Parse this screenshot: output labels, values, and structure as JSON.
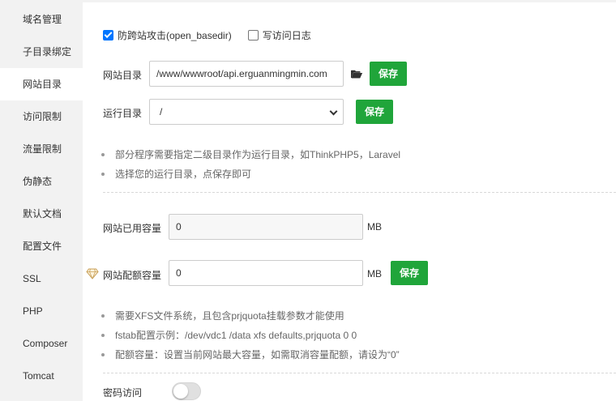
{
  "sidebar": {
    "items": [
      {
        "label": "域名管理"
      },
      {
        "label": "子目录绑定"
      },
      {
        "label": "网站目录"
      },
      {
        "label": "访问限制"
      },
      {
        "label": "流量限制"
      },
      {
        "label": "伪静态"
      },
      {
        "label": "默认文档"
      },
      {
        "label": "配置文件"
      },
      {
        "label": "SSL"
      },
      {
        "label": "PHP"
      },
      {
        "label": "Composer"
      },
      {
        "label": "Tomcat"
      }
    ],
    "active_index": 2
  },
  "options": {
    "open_basedir_label": "防跨站攻击(open_basedir)",
    "open_basedir_checked": true,
    "access_log_label": "写访问日志",
    "access_log_checked": false
  },
  "site_dir": {
    "label": "网站目录",
    "value": "/www/wwwroot/api.erguanmingmin.com",
    "save_label": "保存",
    "folder_icon": "folder-open-icon"
  },
  "run_dir": {
    "label": "运行目录",
    "selected": "/",
    "save_label": "保存"
  },
  "dir_tips": [
    "部分程序需要指定二级目录作为运行目录，如ThinkPHP5，Laravel",
    "选择您的运行目录，点保存即可"
  ],
  "quota": {
    "used_label": "网站已用容量",
    "used_value": "0",
    "used_unit": "MB",
    "quota_label": "网站配额容量",
    "quota_value": "0",
    "quota_unit": "MB",
    "save_label": "保存",
    "premium_icon": "gem-icon"
  },
  "quota_tips": [
    "需要XFS文件系统，且包含prjquota挂载参数才能使用",
    "fstab配置示例：/dev/vdc1 /data xfs defaults,prjquota 0 0",
    "配额容量：设置当前网站最大容量，如需取消容量配额，请设为“0”"
  ],
  "password_access": {
    "label": "密码访问",
    "enabled": false
  },
  "colors": {
    "accent_green": "#20a53a",
    "checkbox_blue": "#0075ff",
    "sidebar_bg": "#f2f2f2"
  }
}
